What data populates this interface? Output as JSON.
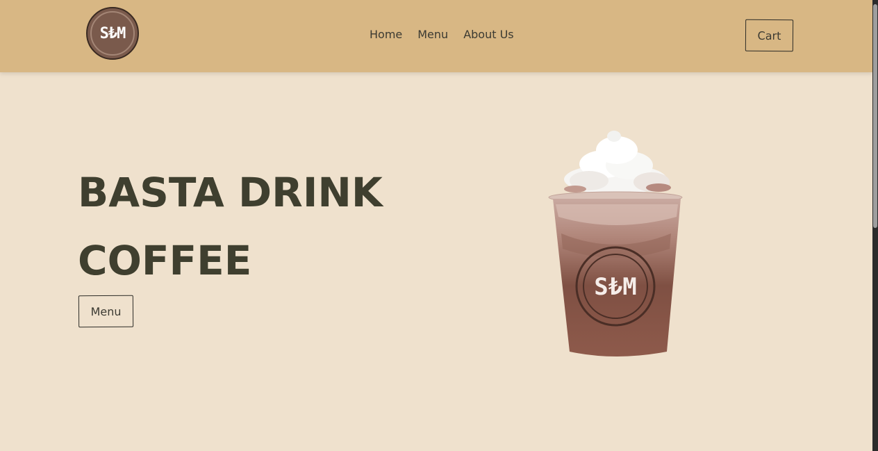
{
  "header": {
    "logo_text": "S₺M",
    "nav": [
      "Home",
      "Menu",
      "About Us"
    ],
    "cart_label": "Cart"
  },
  "hero": {
    "title_line1": "BASTA DRINK",
    "title_line2": "COFFEE",
    "menu_button_label": "Menu",
    "product_logo_text": "S₺M"
  },
  "colors": {
    "header_bg": "#d8b784",
    "page_bg": "#efe1cd",
    "title_text": "#3f3f2f",
    "logo_brown": "#7a5a4c"
  }
}
